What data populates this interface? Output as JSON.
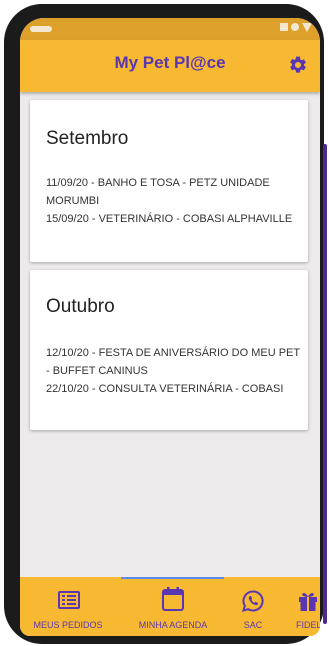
{
  "app": {
    "title": "My Pet Pl@ce"
  },
  "agenda": [
    {
      "month": "Setembro",
      "lines": [
        "11/09/20 - BANHO E TOSA - PETZ UNIDADE MORUMBI",
        "15/09/20 - VETERINÁRIO - COBASI ALPHAVILLE"
      ]
    },
    {
      "month": "Outubro",
      "lines": [
        "12/10/20 - FESTA DE ANIVERSÁRIO DO MEU PET - BUFFET CANINUS",
        "22/10/20 - CONSULTA VETERINÁRIA - COBASI"
      ]
    }
  ],
  "bottom_nav": {
    "items": [
      {
        "label": "MEUS PEDIDOS",
        "icon": "list-icon"
      },
      {
        "label": "MINHA AGENDA",
        "icon": "calendar-icon",
        "active": true
      },
      {
        "label": "SAC",
        "icon": "whatsapp-icon"
      },
      {
        "label": "FIDELID",
        "icon": "gift-icon"
      }
    ]
  },
  "colors": {
    "brand_yellow": "#f7b931",
    "brand_purple": "#5b36b2",
    "active_indicator": "#5b8de8"
  }
}
